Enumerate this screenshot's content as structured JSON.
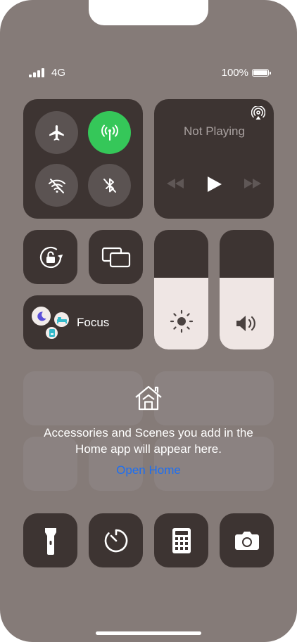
{
  "status_bar": {
    "network": "4G",
    "battery_percent": "100%"
  },
  "media": {
    "title": "Not Playing"
  },
  "focus": {
    "label": "Focus"
  },
  "home": {
    "message_line1": "Accessories and Scenes you add in the",
    "message_line2": "Home app will appear here.",
    "open_home_label": "Open Home"
  },
  "sliders": {
    "brightness_level": 0.6,
    "volume_level": 0.6
  },
  "colors": {
    "background": "#857b78",
    "tile": "#3d3432",
    "cellular_active": "#35c759",
    "link": "#1d6ff2"
  }
}
